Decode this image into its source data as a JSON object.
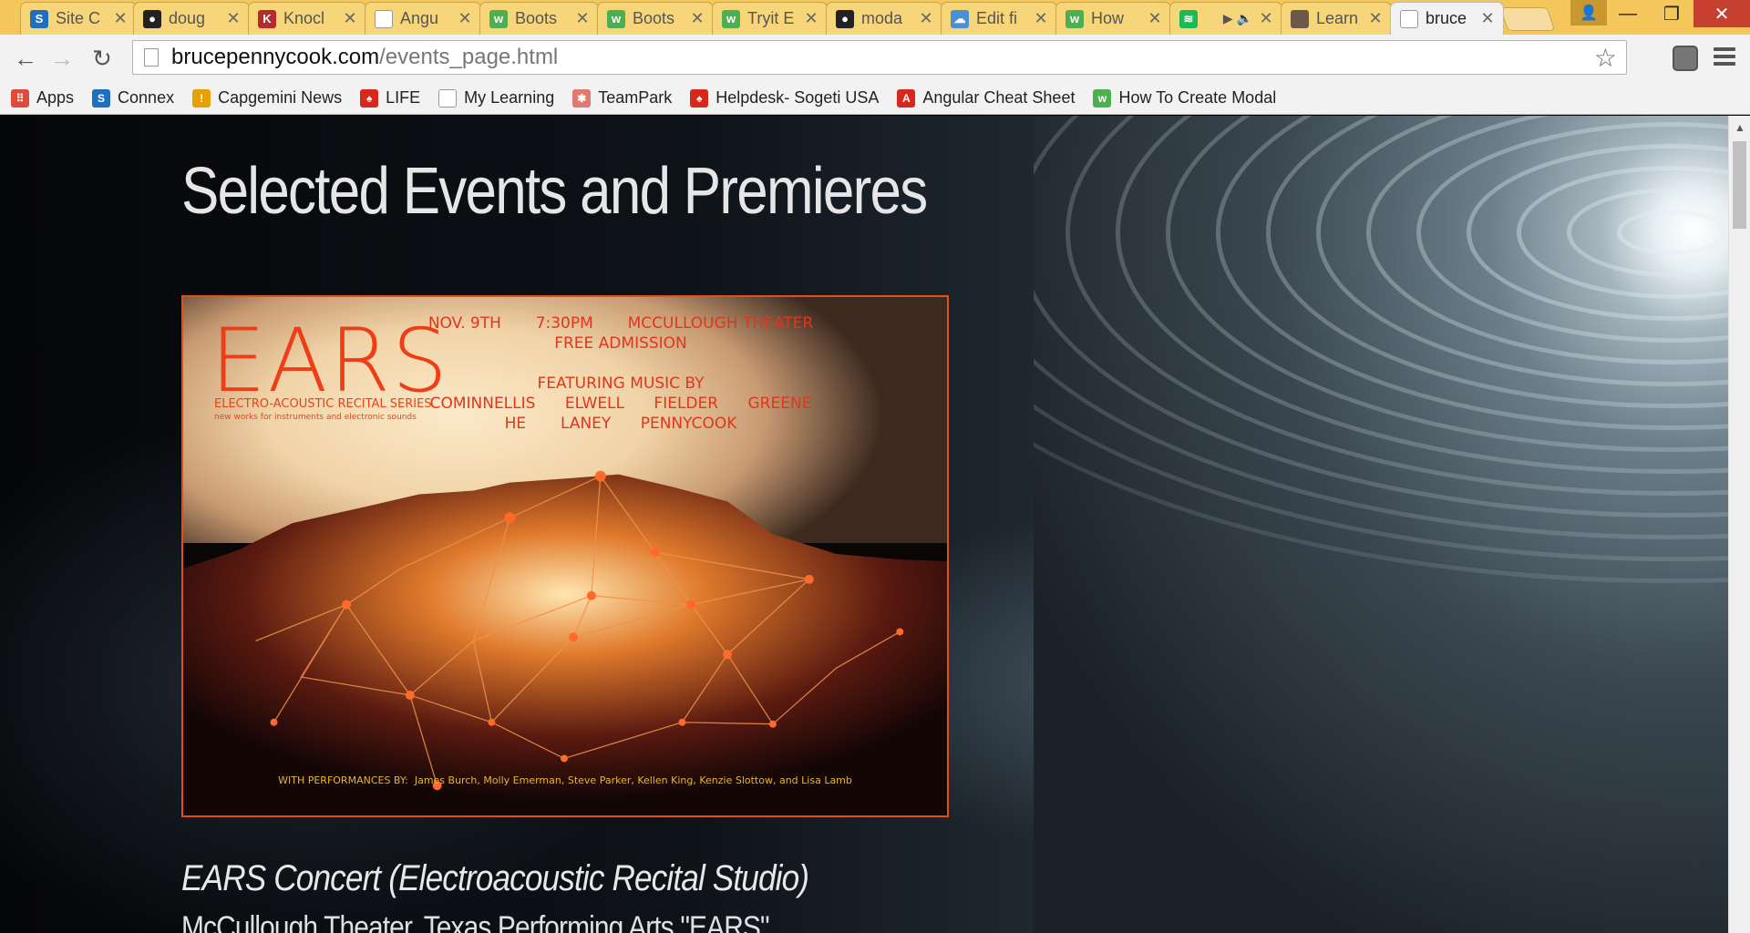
{
  "browser": {
    "tabs": [
      {
        "title": "Site C",
        "favicon": "sharepoint-icon",
        "color": "#1f6fc1",
        "glyph": "S"
      },
      {
        "title": "doug",
        "favicon": "github-icon",
        "color": "#222222",
        "glyph": "●"
      },
      {
        "title": "Knocl",
        "favicon": "knockout-icon",
        "color": "#b42b2b",
        "glyph": "K"
      },
      {
        "title": "Angu",
        "favicon": "page-icon",
        "color": "#ffffff",
        "glyph": ""
      },
      {
        "title": "Boots",
        "favicon": "w3-icon",
        "color": "#4caf50",
        "glyph": "w"
      },
      {
        "title": "Boots",
        "favicon": "w3-icon",
        "color": "#4caf50",
        "glyph": "w"
      },
      {
        "title": "Tryit E",
        "favicon": "w3-icon",
        "color": "#4caf50",
        "glyph": "w"
      },
      {
        "title": "moda",
        "favicon": "github-icon",
        "color": "#222222",
        "glyph": "●"
      },
      {
        "title": "Edit fi",
        "favicon": "cloud-icon",
        "color": "#4a90d9",
        "glyph": "☁"
      },
      {
        "title": "How",
        "favicon": "w3-icon",
        "color": "#4caf50",
        "glyph": "w"
      },
      {
        "title": "",
        "favicon": "spotify-icon",
        "color": "#1db954",
        "glyph": "≋",
        "extra": "▶ 🔈"
      },
      {
        "title": "Learn",
        "favicon": "avatar-icon",
        "color": "#6b5a4a",
        "glyph": ""
      },
      {
        "title": "bruce",
        "favicon": "page-icon",
        "color": "#ffffff",
        "glyph": "",
        "active": true
      }
    ],
    "url_host": "brucepennycook.com",
    "url_path": "/events_page.html",
    "bookmarks": [
      {
        "label": "Apps",
        "icon": "apps-grid-icon",
        "color": "#e04a3a",
        "glyph": "⠿"
      },
      {
        "label": "Connex",
        "icon": "sharepoint-icon",
        "color": "#1f6fc1",
        "glyph": "S"
      },
      {
        "label": "Capgemini News",
        "icon": "capgemini-icon",
        "color": "#e8a000",
        "glyph": "!"
      },
      {
        "label": "LIFE",
        "icon": "life-icon",
        "color": "#d6281c",
        "glyph": "♠"
      },
      {
        "label": "My Learning",
        "icon": "page-icon",
        "color": "#ffffff",
        "glyph": ""
      },
      {
        "label": "TeamPark",
        "icon": "teampark-icon",
        "color": "#e07a70",
        "glyph": "✱"
      },
      {
        "label": "Helpdesk- Sogeti USA",
        "icon": "helpdesk-icon",
        "color": "#d6281c",
        "glyph": "♠"
      },
      {
        "label": "Angular Cheat Sheet",
        "icon": "angular-icon",
        "color": "#d6281c",
        "glyph": "A"
      },
      {
        "label": "How To Create Modal",
        "icon": "w3-icon",
        "color": "#4caf50",
        "glyph": "w"
      }
    ]
  },
  "page": {
    "heading": "Selected Events and Premieres",
    "poster": {
      "logo": "EARS",
      "series": "ELECTRO-ACOUSTIC RECITAL SERIES",
      "series_sub": "new works for instruments and electronic sounds",
      "info_line1": "NOV. 9TH       7:30PM       MCCULLOUGH THEATER",
      "info_line2": "FREE ADMISSION",
      "info_line3": "FEATURING MUSIC BY",
      "info_line4": "COMINNELLIS      ELWELL      FIELDER      GREENE",
      "info_line5": "HE       LANEY      PENNYCOOK",
      "performers": "WITH PERFORMANCES BY:  James Burch, Molly Emerman, Steve Parker, Kellen King, Kenzie Slottow, and Lisa Lamb"
    },
    "caption_title": "EARS Concert (Electroacoustic Recital Studio)",
    "caption_sub": "McCullough Theater, Texas Performing Arts \"EARS\""
  }
}
